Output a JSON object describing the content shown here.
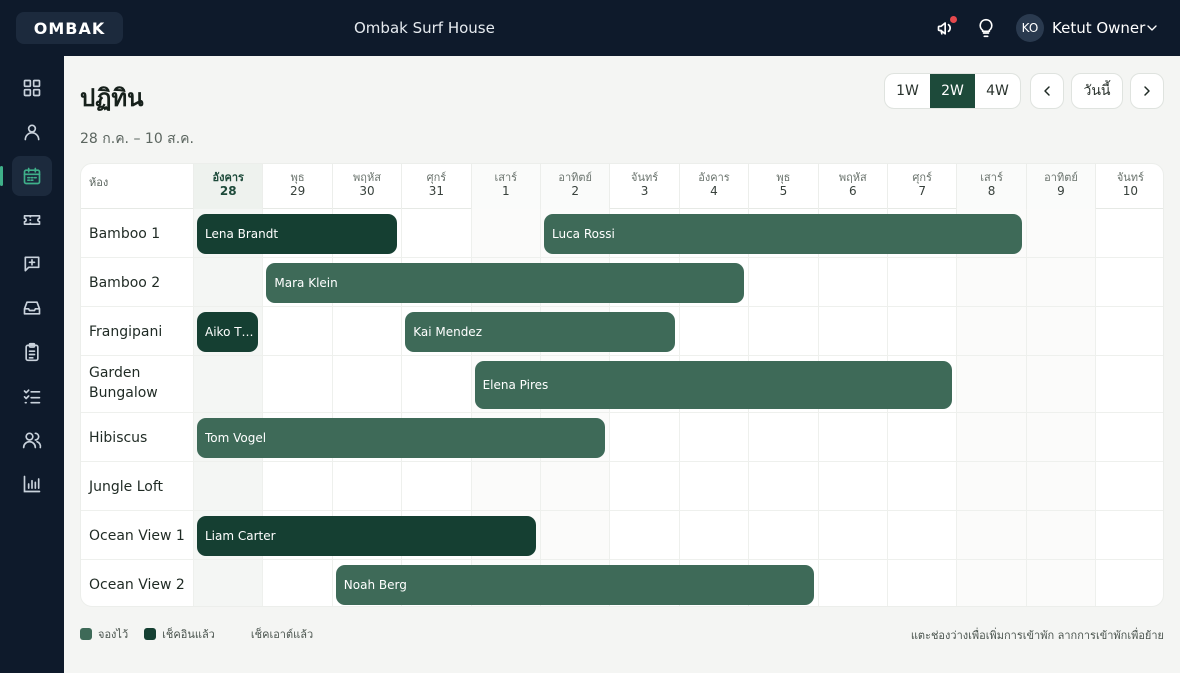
{
  "app": {
    "logo": "OMBAK",
    "property_name": "Ombak Surf House",
    "user": {
      "initials": "KO",
      "name": "Ketut Owner"
    }
  },
  "sidebar": {
    "items": [
      {
        "icon": "grid-icon",
        "active": false
      },
      {
        "icon": "user-icon",
        "active": false
      },
      {
        "icon": "calendar-icon",
        "active": true
      },
      {
        "icon": "ticket-icon",
        "active": false
      },
      {
        "icon": "message-plus-icon",
        "active": false
      },
      {
        "icon": "inbox-icon",
        "active": false
      },
      {
        "icon": "clipboard-icon",
        "active": false
      },
      {
        "icon": "checklist-icon",
        "active": false
      },
      {
        "icon": "users-icon",
        "active": false
      },
      {
        "icon": "chart-icon",
        "active": false
      }
    ]
  },
  "page": {
    "title": "ปฏิทิน",
    "date_range": "28 ก.ค. – 10 ส.ค."
  },
  "toolbar": {
    "views": [
      "1W",
      "2W",
      "4W"
    ],
    "active_view": "2W",
    "today_label": "วันนี้"
  },
  "calendar": {
    "room_column_label": "ห้อง",
    "days": [
      {
        "name": "อังคาร",
        "date": "28",
        "today": true,
        "weekend": false
      },
      {
        "name": "พุธ",
        "date": "29",
        "today": false,
        "weekend": false
      },
      {
        "name": "พฤหัส",
        "date": "30",
        "today": false,
        "weekend": false
      },
      {
        "name": "ศุกร์",
        "date": "31",
        "today": false,
        "weekend": false
      },
      {
        "name": "เสาร์",
        "date": "1",
        "today": false,
        "weekend": true
      },
      {
        "name": "อาทิตย์",
        "date": "2",
        "today": false,
        "weekend": true
      },
      {
        "name": "จันทร์",
        "date": "3",
        "today": false,
        "weekend": false
      },
      {
        "name": "อังคาร",
        "date": "4",
        "today": false,
        "weekend": false
      },
      {
        "name": "พุธ",
        "date": "5",
        "today": false,
        "weekend": false
      },
      {
        "name": "พฤหัส",
        "date": "6",
        "today": false,
        "weekend": false
      },
      {
        "name": "ศุกร์",
        "date": "7",
        "today": false,
        "weekend": false
      },
      {
        "name": "เสาร์",
        "date": "8",
        "today": false,
        "weekend": true
      },
      {
        "name": "อาทิตย์",
        "date": "9",
        "today": false,
        "weekend": true
      },
      {
        "name": "จันทร์",
        "date": "10",
        "today": false,
        "weekend": false
      }
    ],
    "rooms": [
      {
        "name": "Bamboo 1",
        "bookings": [
          {
            "guest": "Lena Brandt",
            "start": 0,
            "nights": 3,
            "status": "checked_in"
          },
          {
            "guest": "Luca Rossi",
            "start": 5,
            "nights": 7,
            "status": "reserved"
          }
        ]
      },
      {
        "name": "Bamboo 2",
        "bookings": [
          {
            "guest": "Mara Klein",
            "start": 1,
            "nights": 7,
            "status": "reserved"
          }
        ]
      },
      {
        "name": "Frangipani",
        "bookings": [
          {
            "guest": "Aiko T…",
            "start": 0,
            "nights": 1,
            "status": "checked_in"
          },
          {
            "guest": "Kai Mendez",
            "start": 3,
            "nights": 4,
            "status": "reserved"
          }
        ]
      },
      {
        "name": "Garden Bungalow",
        "bookings": [
          {
            "guest": "Elena Pires",
            "start": 4,
            "nights": 7,
            "status": "reserved"
          }
        ]
      },
      {
        "name": "Hibiscus",
        "bookings": [
          {
            "guest": "Tom Vogel",
            "start": 0,
            "nights": 6,
            "status": "reserved"
          }
        ]
      },
      {
        "name": "Jungle Loft",
        "bookings": []
      },
      {
        "name": "Ocean View 1",
        "bookings": [
          {
            "guest": "Liam Carter",
            "start": 0,
            "nights": 5,
            "status": "checked_in"
          }
        ]
      },
      {
        "name": "Ocean View 2",
        "bookings": [
          {
            "guest": "Noah Berg",
            "start": 2,
            "nights": 7,
            "status": "reserved"
          }
        ]
      }
    ]
  },
  "legend": {
    "items": [
      {
        "label": "จองไว้",
        "color": "#3e6a58"
      },
      {
        "label": "เช็คอินแล้ว",
        "color": "#153f32"
      },
      {
        "label": "เช็คเอาต์แล้ว",
        "color": ""
      }
    ],
    "hint": "แตะช่องว่างเพื่อเพิ่มการเข้าพัก ลากการเข้าพักเพื่อย้าย"
  },
  "colors": {
    "reserved": "#3e6a58",
    "checked_in": "#153f32",
    "accent": "#1d4a3a"
  }
}
